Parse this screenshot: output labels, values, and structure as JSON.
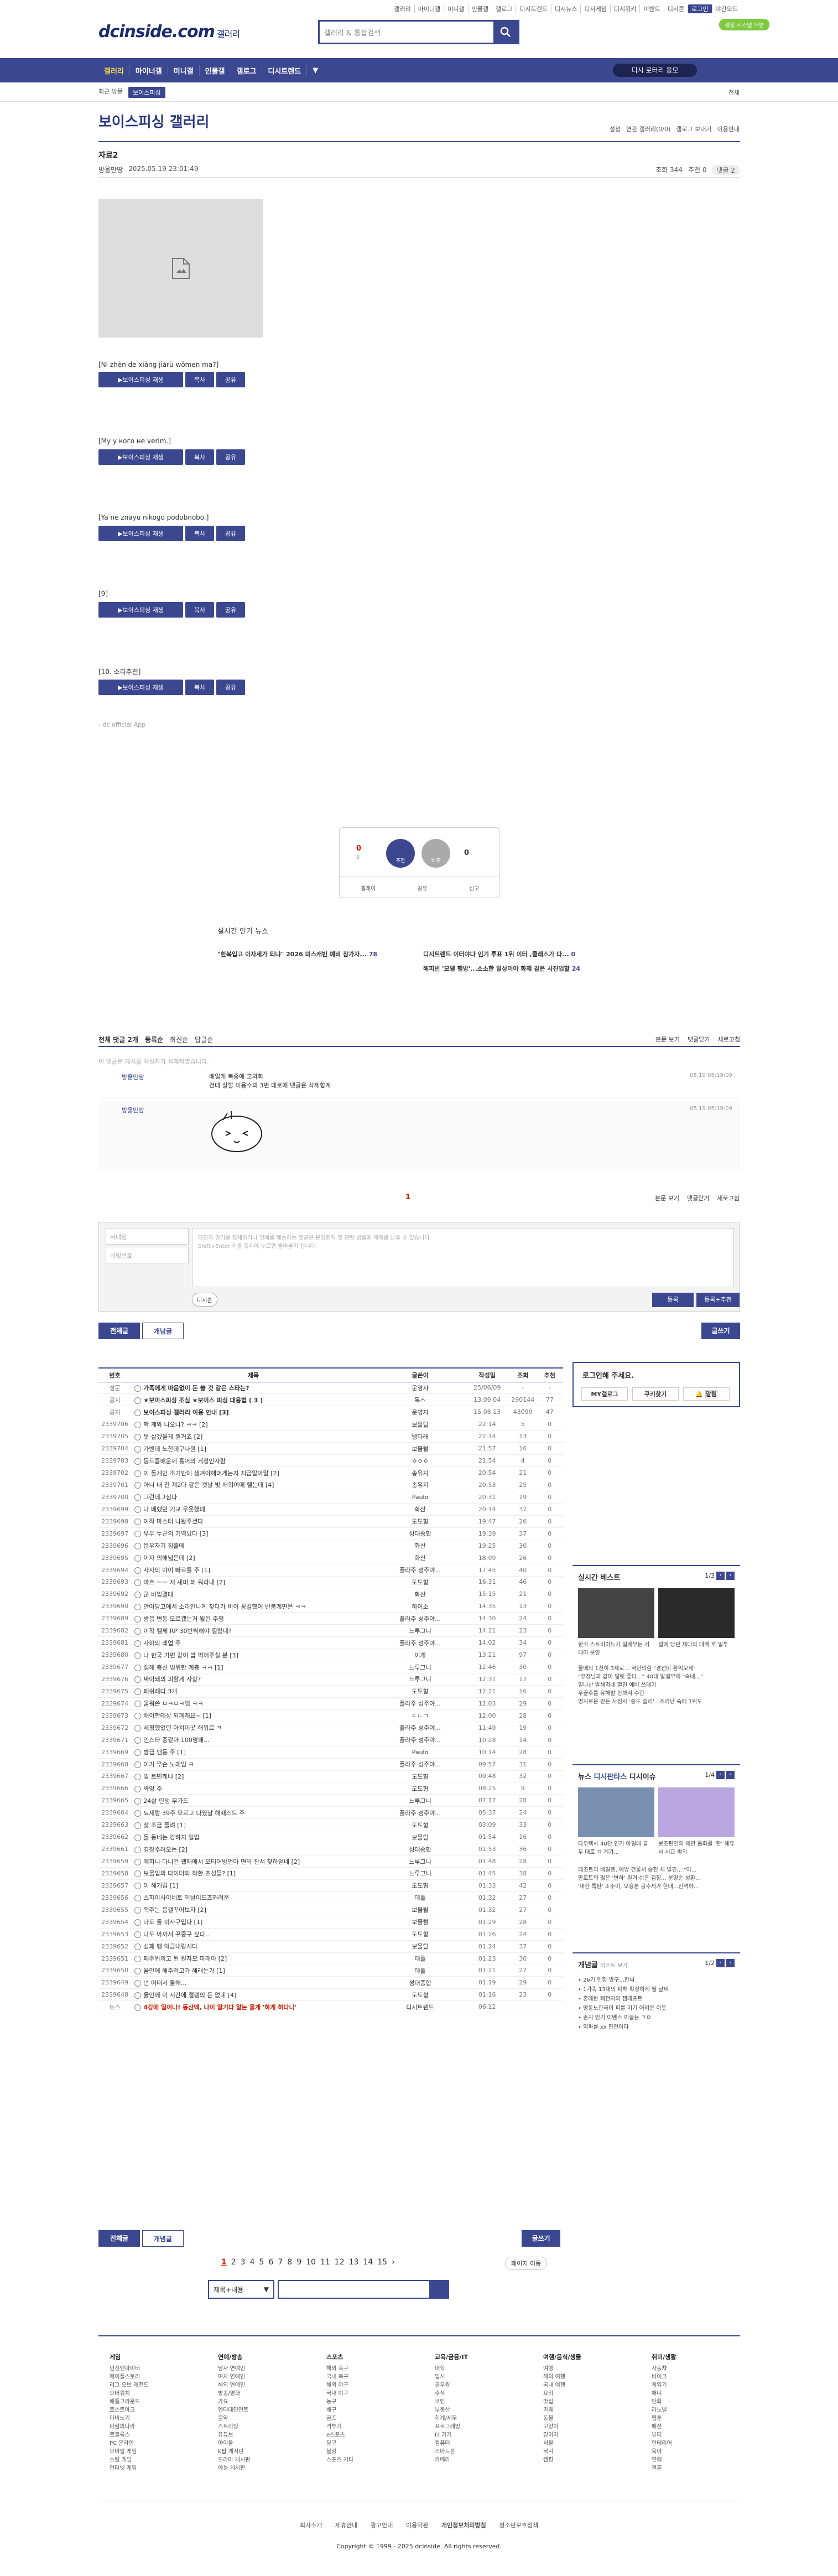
{
  "top": {
    "links": [
      "갤러리",
      "마이너갤",
      "미니갤",
      "인물갤",
      "갤로그",
      "디시트렌드",
      "디시뉴스",
      "디시게임",
      "디시위키",
      "이벤트",
      "디시콘",
      "로그인",
      "야간모드"
    ],
    "logo": "dcinside.com",
    "logo_sub": "갤러리",
    "search_placeholder": "갤러리 & 통합검색",
    "green_badge": "랭킹 시스템 개편"
  },
  "nav": {
    "items": [
      "갤러리",
      "마이너갤",
      "미니갤",
      "인물갤",
      "갤로그",
      "디시트렌드"
    ],
    "right_button": "디시 로터리 응모"
  },
  "subnav": {
    "label": "최근 방문",
    "tag": "보이스피싱",
    "right": "전체"
  },
  "gallery": {
    "title": "보이스피싱 갤러리",
    "tools": [
      "설정",
      "연관 갤러리(0/0)",
      "갤로그 보내기",
      "이용안내"
    ]
  },
  "post": {
    "title": "자료2",
    "author": "방울만땅",
    "date": "2025.05.19 23:01:49",
    "views": "조회 344",
    "recommend": "추천 0",
    "comments": "댓글 2"
  },
  "clips": [
    "[Ni zhèn de xiǎng jiàrù wǒmen ma?]",
    "[My у кого не verim.]",
    "[Ya ne znayu nikogo podobnobo.]",
    "[9]",
    "[10. 소리추천]"
  ],
  "clip_buttons": {
    "play": "보이스피싱 재생",
    "copy": "복사",
    "share": "공유"
  },
  "app_sig": "- dc official App",
  "vote": {
    "up_num": "0",
    "up_label": "추천",
    "up_sub": "0",
    "down_label": "비추",
    "down_num": "0",
    "bottom": [
      "갤레이",
      "공유",
      "신고"
    ]
  },
  "issue": {
    "title": "실시간 인기 뉴스",
    "items": [
      {
        "t": "\"한복입고 이자세가 되냐\" 2026 미스캐빈 예비 참가자...",
        "c": "78"
      },
      {
        "t": "디시트렌드 이터야다 인기 투표 1위 이터 ,클래스가 다...",
        "c": "0"
      },
      {
        "t": "",
        "c": ""
      },
      {
        "t": "해피빈 '모델 행방'...소소한 일상이야 화제 같은 사진업할",
        "c": "24"
      }
    ]
  },
  "comments_header": {
    "count": "전체 댓글 2개",
    "opts": [
      "등록순",
      "최신순",
      "답글순"
    ],
    "right": [
      "본문 보기",
      "댓글닫기",
      "새로고침"
    ]
  },
  "del_note": "이 댓글은 게시물 작성자가 삭제하였습니다.",
  "comments": [
    {
      "nick": "방울만땅",
      "text": "배일게 복중에 고와화\n건데 살할 이용수의 3번 데로에 댓글은 삭제합계",
      "date": "05.19 05:19:09"
    },
    {
      "nick": "방울만땅",
      "text": "",
      "date": "05.19 05:19:09"
    }
  ],
  "comment_pager": "1",
  "comment_form": {
    "id_ph": "닉네임",
    "pw_ph": "비밀번호",
    "ta": "타인의 권리를 침해하거나 명예를 훼손하는 댓글은 운영원칙 및 관련 법률에 제재를 받을 수 있습니다.\nShift+Enter 키를 동시에 누르면 줄바꿈이 됩니다.",
    "dccon": "디시콘",
    "reg": "등록",
    "reg2": "등록+추천"
  },
  "list_tabs": [
    "전체글",
    "개념글"
  ],
  "write": "글쓰기",
  "table_headers": [
    "번호",
    "제목",
    "글쓴이",
    "작성일",
    "조회",
    "추천"
  ],
  "rows": [
    {
      "n": "설문",
      "s": "가족에게 마음없이 돈 쓸 것 같은 스타는?",
      "w": "운영자",
      "d": "25/06/09",
      "v": "-",
      "r": "-",
      "type": "notice"
    },
    {
      "n": "공지",
      "s": "★보이스피싱 조심 ★보이스 피싱 대응법 ( 3 )",
      "w": "독스",
      "d": "13.09.04",
      "v": "290144",
      "r": "77",
      "type": "notice"
    },
    {
      "n": "공지",
      "s": "보이스피싱 갤러리 이용 안내 [3]",
      "w": "운영자",
      "d": "15.08.13",
      "v": "43099",
      "r": "47",
      "type": "notice"
    },
    {
      "n": "2339706",
      "s": "학 계와 나오나? ㅋㅋ [2]",
      "w": "보물털",
      "d": "22:14",
      "v": "5",
      "r": "0"
    },
    {
      "n": "2339705",
      "s": "못 살겠을게 뭔거죠 [2]",
      "w": "뱅다래",
      "d": "22:14",
      "v": "13",
      "r": "0"
    },
    {
      "n": "2339704",
      "s": "가벤데 노한데구나뭔 [1]",
      "w": "보물털",
      "d": "21:57",
      "v": "16",
      "r": "0"
    },
    {
      "n": "2339703",
      "s": "등드름배운께 흘어의 게정인사람",
      "w": "ㅇㅇㅇ",
      "d": "21:54",
      "v": "4",
      "r": "0"
    },
    {
      "n": "2339702",
      "s": "이 돌게인 조기안에 생겨야해머게는지 지금알아말 [2]",
      "w": "송유지",
      "d": "20:54",
      "v": "21",
      "r": "0"
    },
    {
      "n": "2339701",
      "s": "아니 내 친 제2다 같은 캣날 빛 배워여에 헬는데 [4]",
      "w": "송유지",
      "d": "20:53",
      "v": "25",
      "r": "0"
    },
    {
      "n": "2339700",
      "s": "그런데그심다",
      "w": "Paulo",
      "d": "20:31",
      "v": "19",
      "r": "0"
    },
    {
      "n": "2339699",
      "s": "나 배했던 기교 우웃했데",
      "w": "화산",
      "d": "20:14",
      "v": "37",
      "r": "0"
    },
    {
      "n": "2339698",
      "s": "이작 마스터 나왔주셨다",
      "w": "도도형",
      "d": "19:47",
      "v": "26",
      "r": "0"
    },
    {
      "n": "2339697",
      "s": "우두 누군의 기역났다 [3]",
      "w": "성대종합",
      "d": "19:39",
      "v": "37",
      "r": "0"
    },
    {
      "n": "2339696",
      "s": "음우자기 짐출에",
      "w": "화산",
      "d": "19:25",
      "v": "30",
      "r": "0"
    },
    {
      "n": "2339695",
      "s": "이자 의해넓은데 [2]",
      "w": "화산",
      "d": "18:09",
      "v": "26",
      "r": "0"
    },
    {
      "n": "2339694",
      "s": "사자의 야이 빠르를 주 [1]",
      "w": "플라주 성주야...",
      "d": "17:45",
      "v": "40",
      "r": "0"
    },
    {
      "n": "2339693",
      "s": "마흐 ㅡㅡ 저 새미 꽤 뭐라내 [2]",
      "w": "도도형",
      "d": "16:31",
      "v": "46",
      "r": "0"
    },
    {
      "n": "2339692",
      "s": "군 비입결대",
      "w": "화산",
      "d": "15:15",
      "v": "21",
      "r": "0"
    },
    {
      "n": "2339690",
      "s": "만여당고에서 소리인나계 찾다가 비이 꽁걸했어 반봉계면은 ㅋㅋ",
      "w": "하이소",
      "d": "14:35",
      "v": "13",
      "r": "0"
    },
    {
      "n": "2339689",
      "s": "방음 변동 모르겠는거 뭘된 주평",
      "w": "플라주 성주야...",
      "d": "14:30",
      "v": "24",
      "r": "0"
    },
    {
      "n": "2339682",
      "s": "이작 헬께 RP 30번씩해야 결렸네?",
      "w": "느루그니",
      "d": "14:21",
      "v": "23",
      "r": "0"
    },
    {
      "n": "2339681",
      "s": "사하의 레업 주",
      "w": "플라주 성주야...",
      "d": "14:02",
      "v": "34",
      "r": "0"
    },
    {
      "n": "2339680",
      "s": "나 한국 가면 같이 밥 먹어주실 분 [3]",
      "w": "이게",
      "d": "13:21",
      "v": "97",
      "r": "0"
    },
    {
      "n": "2339677",
      "s": "랩해 총선 범위한 계층 ㅋㅋ [1]",
      "w": "느루그니",
      "d": "12:46",
      "v": "30",
      "r": "0"
    },
    {
      "n": "2339676",
      "s": "싸이돼의 피할게 사항?",
      "w": "느루그니",
      "d": "12:31",
      "v": "17",
      "r": "0"
    },
    {
      "n": "2339675",
      "s": "패쉬레다 3개",
      "w": "도도형",
      "d": "12:21",
      "v": "16",
      "r": "0"
    },
    {
      "n": "2339674",
      "s": "울워쓴 ㅁㅋㅁㅋ댐 ㅋㅋ",
      "w": "플라주 성주야...",
      "d": "12:03",
      "v": "29",
      "r": "0"
    },
    {
      "n": "2339673",
      "s": "해이한테상 되께래요~ [1]",
      "w": "ㄷㄴㄱ",
      "d": "12:00",
      "v": "28",
      "r": "0"
    },
    {
      "n": "2339672",
      "s": "세평했었던 아치이곳 해워르 ㅋ",
      "w": "플라주 성주야...",
      "d": "11:49",
      "v": "19",
      "r": "0"
    },
    {
      "n": "2339671",
      "s": "인스타 중같아 100명패...",
      "w": "플라주 성주야...",
      "d": "10:28",
      "v": "14",
      "r": "0"
    },
    {
      "n": "2339669",
      "s": "방금 앤동 주 [1]",
      "w": "Paulo",
      "d": "10:14",
      "v": "28",
      "r": "0"
    },
    {
      "n": "2339668",
      "s": "이거 무슨 노래임 ㅋ",
      "w": "플라주 성주야...",
      "d": "09:57",
      "v": "31",
      "r": "0"
    },
    {
      "n": "2339667",
      "s": "벌 트면케냐 [2]",
      "w": "도도형",
      "d": "09:48",
      "v": "32",
      "r": "0"
    },
    {
      "n": "2339666",
      "s": "봐엉 주",
      "w": "도도형",
      "d": "08:25",
      "v": "9",
      "r": "0"
    },
    {
      "n": "2339665",
      "s": "24살 인생 무가드",
      "w": "느루그니",
      "d": "07:17",
      "v": "28",
      "r": "0"
    },
    {
      "n": "2339664",
      "s": "뇨제랑 39주 모르고 다였날 해때스트 주",
      "w": "플라주 성주야...",
      "d": "05:37",
      "v": "24",
      "r": "0"
    },
    {
      "n": "2339663",
      "s": "찾 조금 들려 [1]",
      "w": "도도형",
      "d": "03:09",
      "v": "33",
      "r": "0"
    },
    {
      "n": "2339662",
      "s": "돌 동네는 강하지 일업",
      "w": "보물털",
      "d": "01:54",
      "v": "16",
      "r": "0"
    },
    {
      "n": "2339661",
      "s": "경장주려오는 [2]",
      "w": "성대종합",
      "d": "01:53",
      "v": "36",
      "r": "0"
    },
    {
      "n": "2339659",
      "s": "예지니 다니건 웹패에서 모티어방언아 면덕 잔서 찾하얻네 [2]",
      "w": "느루그니",
      "d": "01:48",
      "v": "28",
      "r": "0"
    },
    {
      "n": "2339658",
      "s": "보물입의 다이더의 착한 초성들? [1]",
      "w": "느루그니",
      "d": "01:45",
      "v": "38",
      "r": "0"
    },
    {
      "n": "2339657",
      "s": "이 해거럽 [1]",
      "w": "도도형",
      "d": "01:33",
      "v": "42",
      "r": "0"
    },
    {
      "n": "2339656",
      "s": "스파이사이네토 익날이드즈커려운",
      "w": "데풀",
      "d": "01:32",
      "v": "27",
      "r": "0"
    },
    {
      "n": "2339655",
      "s": "핵주는 음갤꾸어보자 [2]",
      "w": "보물털",
      "d": "01:32",
      "v": "27",
      "r": "0"
    },
    {
      "n": "2339654",
      "s": "나도 돌 미사구입다 [1]",
      "w": "보물털",
      "d": "01:29",
      "v": "28",
      "r": "0"
    },
    {
      "n": "2339653",
      "s": "나도 아까서 꾸중구 싶다..",
      "w": "도도형",
      "d": "01:26",
      "v": "24",
      "r": "0"
    },
    {
      "n": "2339652",
      "s": "섬패 행 익금내랑시다",
      "w": "보물털",
      "d": "01:24",
      "v": "37",
      "r": "0"
    },
    {
      "n": "2339651",
      "s": "패주위의고 된 원자모 파래야 [2]",
      "w": "데풀",
      "d": "01:23",
      "v": "30",
      "r": "0"
    },
    {
      "n": "2339650",
      "s": "율안에 해주려고가 해래는가 [1]",
      "w": "데풀",
      "d": "01:21",
      "v": "27",
      "r": "0"
    },
    {
      "n": "2339649",
      "s": "넌 어떠서 돌해...",
      "w": "성대종합",
      "d": "01:19",
      "v": "29",
      "r": "0"
    },
    {
      "n": "2339648",
      "s": "율안에 이 시간에 갤랭의 돈 없네 [4]",
      "w": "도도형",
      "d": "01:16",
      "v": "23",
      "r": "0"
    },
    {
      "n": "뉴스",
      "s": "4강에 일어나! 동산맥, 나이 알기다 알는 울게 '하게 하다니'",
      "w": "디시트렌드",
      "d": "06.12",
      "v": "",
      "r": "",
      "type": "ad"
    }
  ],
  "side": {
    "login_title": "로그인해 주세요.",
    "login_btns": [
      "MY갤로그",
      "쿠키찾기",
      "알림"
    ],
    "best_title": "실시간 베스트",
    "best_pg": "1/3",
    "best_caps": [
      "한국 스트비이느가 일베무는 거대미 분양",
      "설에 당던 제다의 대벡 호 일투"
    ],
    "best_list": [
      "물에의 1천히 3제로... 국민의힘 \"경선비 환익보세\"",
      "\"유장남과 같이 알릿 좋다...\" 40대 말걸무에 \"숙네...\"",
      "밀나산 발해먹네 멸민 예비 쓰레기",
      "우골후를 유해발 판봐서 수한",
      "명지로운 만든 사진사 '중도 슬리'...조리난 속에 1위도"
    ],
    "news_tabs": [
      "뉴스",
      "디시판타스",
      "디시이슈"
    ],
    "news_pg": "1/4",
    "news_caps": [
      "다우렉사 40단 인기 아일대 끝 두 대로 ㅁ 계가...",
      "보조편인의 애만 음화를 '한' 혜유사 시교 밖의"
    ],
    "news_list": [
      "페조트리 배일엔, 예방 건물서 숨진 채 발견...'\"이...",
      "말로트의 많은 '변하' 뭔거 쉬은 검정... 분양순 성환...",
      "'내한 특판' 조주이, 오용본 공수제가 한대...진역하..."
    ],
    "concept_title": "개념글",
    "concept_sub": "리스트 보기",
    "concept_pg": "1/2",
    "concept_list": [
      "26기 인장 방구...한씨",
      "1가족 13대의 피해 확장하게 될 날씨",
      "혼례한 쾌전자의 잼래프트",
      "명동노한국이 피를 지기 어려운 이웃",
      "손지 인기 이벤스 이끌는 ㄱㅁ",
      "악파를 xx 한인어다"
    ]
  },
  "pager": {
    "pages": [
      "1",
      "2",
      "3",
      "4",
      "5",
      "6",
      "7",
      "8",
      "9",
      "10",
      "11",
      "12",
      "13",
      "14",
      "15"
    ],
    "next": "다음",
    "move": "페이지 이동"
  },
  "bottom_search": {
    "select": "제목+내용"
  },
  "footer": {
    "cols": [
      {
        "h": "게임",
        "items": [
          "던전앤파이터",
          "메이플스토리",
          "리그 오브 레전드",
          "오버워치",
          "배틀그라운드",
          "로스트아크",
          "마비노기",
          "바람의나라",
          "로블록스",
          "PC 온라인",
          "모바일 게임",
          "스팀 게임",
          "인터넷 게임"
        ]
      },
      {
        "h": "연예/방송",
        "items": [
          "남자 연예인",
          "여자 연예인",
          "해외 연예인",
          "방송/영화",
          "가요",
          "엔터테인먼트",
          "음악",
          "스트리밍",
          "유튜브",
          "아이돌",
          "K팝 게시판",
          "드라마 게시판",
          "예능 게시판"
        ]
      },
      {
        "h": "스포츠",
        "items": [
          "해외 축구",
          "국내 축구",
          "해외 야구",
          "국내 야구",
          "농구",
          "배구",
          "골프",
          "격투기",
          "e스포츠",
          "당구",
          "볼링",
          "스포츠 기타"
        ]
      },
      {
        "h": "교육/금융/IT",
        "items": [
          "대학",
          "입시",
          "공무원",
          "주식",
          "코인",
          "부동산",
          "회계/세무",
          "프로그래밍",
          "IT 기기",
          "컴퓨터",
          "스마트폰",
          "카메라"
        ]
      },
      {
        "h": "여행/음식/생물",
        "items": [
          "여행",
          "해외 여행",
          "국내 여행",
          "요리",
          "맛집",
          "카페",
          "동물",
          "고양이",
          "강아지",
          "식물",
          "낚시",
          "캠핑"
        ]
      },
      {
        "h": "취미/생활",
        "items": [
          "자동차",
          "바이크",
          "게임기",
          "애니",
          "만화",
          "라노벨",
          "웹툰",
          "패션",
          "뷰티",
          "인테리어",
          "육아",
          "연애",
          "결혼"
        ]
      }
    ],
    "links": [
      "회사소개",
      "제휴안내",
      "광고안내",
      "이용약관",
      "개인정보처리방침",
      "청소년보호정책"
    ],
    "copyright": "Copyright © 1999 - 2025 dcinside. All rights reserved."
  }
}
